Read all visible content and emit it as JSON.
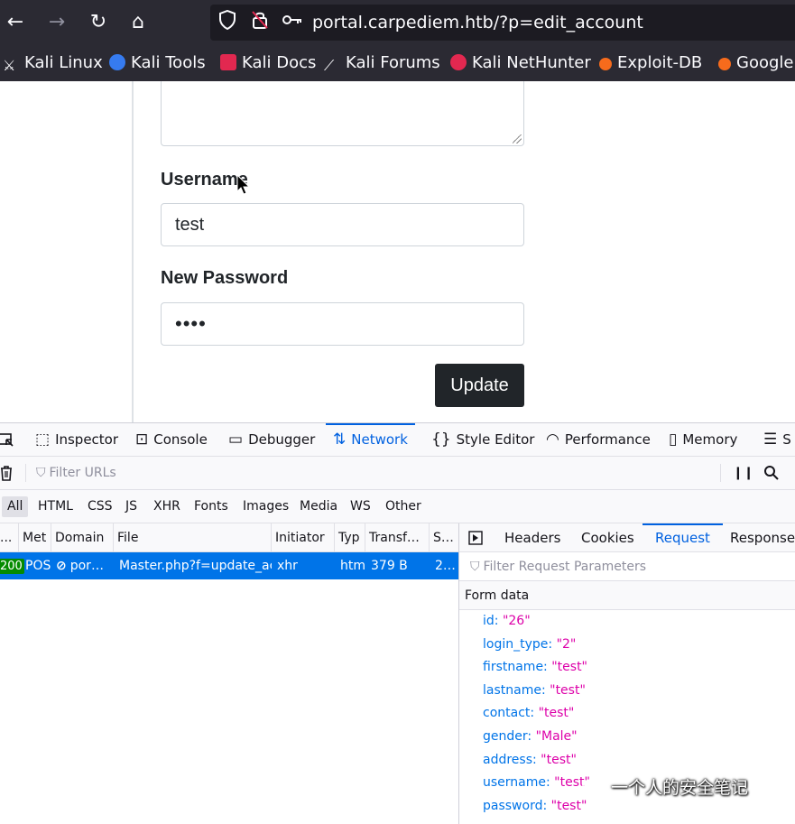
{
  "browser": {
    "url": "portal.carpediem.htb/?p=edit_account",
    "bookmarks": [
      {
        "label": "Kali Linux",
        "icon": "kali-dragon-icon"
      },
      {
        "label": "Kali Tools",
        "icon": "kali-tools-icon"
      },
      {
        "label": "Kali Docs",
        "icon": "kali-docs-icon"
      },
      {
        "label": "Kali Forums",
        "icon": "kali-forums-icon"
      },
      {
        "label": "Kali NetHunter",
        "icon": "nethunter-icon"
      },
      {
        "label": "Exploit-DB",
        "icon": "exploit-db-icon"
      },
      {
        "label": "Google",
        "icon": "google-hacking-icon"
      }
    ]
  },
  "form": {
    "username_label": "Username",
    "username_value": "test",
    "password_label": "New Password",
    "password_value": "••••",
    "update_label": "Update"
  },
  "devtools": {
    "tabs": [
      "Inspector",
      "Console",
      "Debugger",
      "Network",
      "Style Editor",
      "Performance",
      "Memory",
      "S"
    ],
    "selected_tab": "Network",
    "filter_placeholder": "Filter URLs",
    "type_filters": [
      "All",
      "HTML",
      "CSS",
      "JS",
      "XHR",
      "Fonts",
      "Images",
      "Media",
      "WS",
      "Other"
    ],
    "columns": [
      "...",
      "Met",
      "Domain",
      "File",
      "Initiator",
      "Typ",
      "Transf…",
      "S…"
    ],
    "request": {
      "status": "200",
      "method": "POS",
      "domain": "por…",
      "file": "Master.php?f=update_acco",
      "initiator": "xhr",
      "type": "html",
      "transferred": "379 B",
      "size": "2…"
    },
    "side_tabs": [
      "Headers",
      "Cookies",
      "Request",
      "Response"
    ],
    "selected_side_tab": "Request",
    "param_filter_placeholder": "Filter Request Parameters",
    "form_data_label": "Form data",
    "params": [
      {
        "key": "id:",
        "value": "\"26\""
      },
      {
        "key": "login_type:",
        "value": "\"2\""
      },
      {
        "key": "firstname:",
        "value": "\"test\""
      },
      {
        "key": "lastname:",
        "value": "\"test\""
      },
      {
        "key": "contact:",
        "value": "\"test\""
      },
      {
        "key": "gender:",
        "value": "\"Male\""
      },
      {
        "key": "address:",
        "value": "\"test\""
      },
      {
        "key": "username:",
        "value": "\"test\""
      },
      {
        "key": "password:",
        "value": "\"test\""
      }
    ]
  },
  "watermark": "一个人的安全笔记",
  "colors": {
    "chrome": "#2b2a33",
    "accent": "#0061e0",
    "selected_row": "#0074e8",
    "status_ok": "#058b00",
    "param_value": "#dd00a9"
  }
}
